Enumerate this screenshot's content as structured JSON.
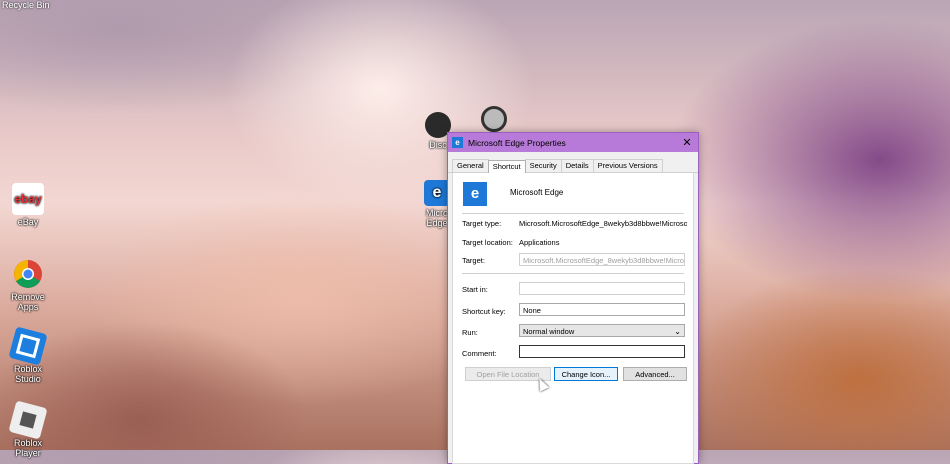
{
  "desktop": {
    "recycle_bin": "Recycle Bin",
    "icons": [
      {
        "label": "eBay",
        "icon": "ebay-icon"
      },
      {
        "label": "Remove\nApps",
        "icon": "chrome-icon"
      },
      {
        "label": "Roblox\nStudio",
        "icon": "roblox-studio-icon"
      },
      {
        "label": "Roblox Player",
        "icon": "roblox-player-icon"
      }
    ],
    "partial_labels": [
      "Disc",
      "Micro\nEdge"
    ]
  },
  "dialog": {
    "title": "Microsoft Edge Properties",
    "tabs": [
      "General",
      "Shortcut",
      "Security",
      "Details",
      "Previous Versions"
    ],
    "active_tab": "Shortcut",
    "app_name": "Microsoft Edge",
    "target_type_label": "Target type:",
    "target_type_value": "Microsoft.MicrosoftEdge_8wekyb3d8bbwe!Microso",
    "target_location_label": "Target location:",
    "target_location_value": "Applications",
    "target_label": "Target:",
    "target_value": "Microsoft.MicrosoftEdge_8wekyb3d8bbwe!Micros",
    "start_in_label": "Start in:",
    "start_in_value": "",
    "shortcut_key_label": "Shortcut key:",
    "shortcut_key_value": "None",
    "run_label": "Run:",
    "run_value": "Normal window",
    "comment_label": "Comment:",
    "comment_value": "",
    "buttons": {
      "open_file_location": "Open File Location",
      "change_icon": "Change Icon...",
      "advanced": "Advanced..."
    },
    "close_glyph": "✕"
  }
}
